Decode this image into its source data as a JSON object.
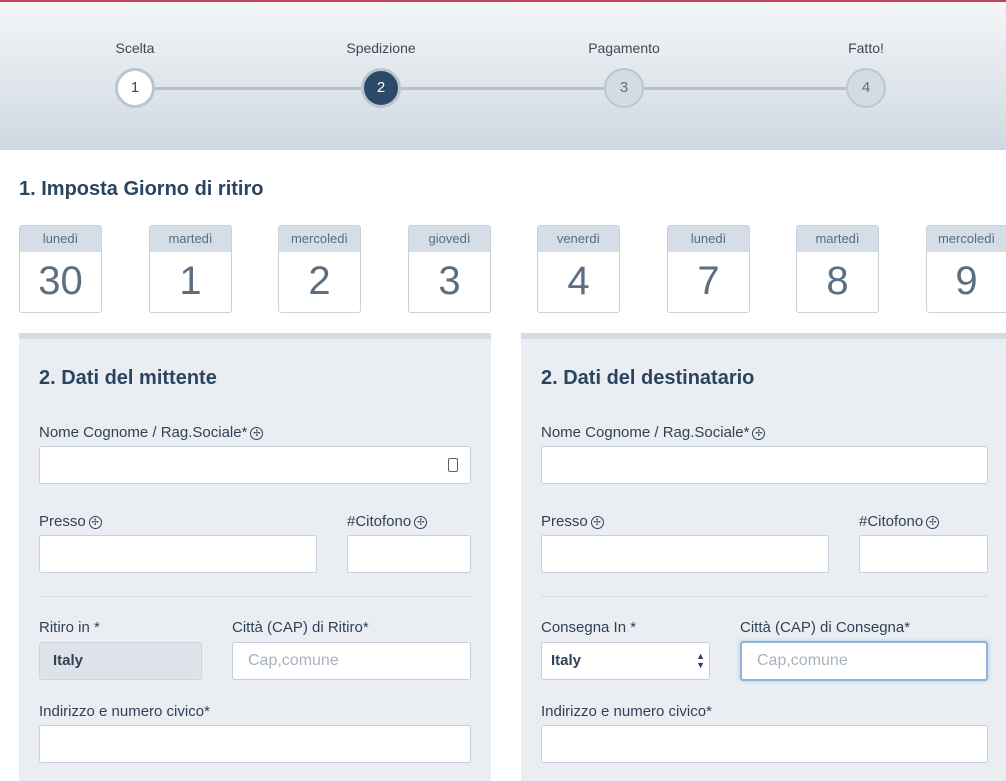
{
  "stepper": {
    "steps": [
      {
        "label": "Scelta",
        "number": "1",
        "state": "done"
      },
      {
        "label": "Spedizione",
        "number": "2",
        "state": "active"
      },
      {
        "label": "Pagamento",
        "number": "3",
        "state": "pending"
      },
      {
        "label": "Fatto!",
        "number": "4",
        "state": "pending"
      }
    ]
  },
  "pickup": {
    "title": "1. Imposta Giorno di ritiro",
    "days": [
      {
        "name": "lunedì",
        "number": "30"
      },
      {
        "name": "martedì",
        "number": "1"
      },
      {
        "name": "mercoledì",
        "number": "2"
      },
      {
        "name": "giovedì",
        "number": "3"
      },
      {
        "name": "venerdì",
        "number": "4"
      },
      {
        "name": "lunedì",
        "number": "7"
      },
      {
        "name": "martedì",
        "number": "8"
      },
      {
        "name": "mercoledì",
        "number": "9"
      }
    ]
  },
  "sender": {
    "title": "2. Dati del mittente",
    "name_label": "Nome Cognome / Rag.Sociale*",
    "name_value": "",
    "presso_label": "Presso",
    "citofono_label": "#Citofono",
    "country_label": "Ritiro in *",
    "country_value": "Italy",
    "city_label": "Città (CAP) di Ritiro*",
    "city_placeholder": "Cap,comune",
    "address_label": "Indirizzo e numero civico*"
  },
  "recipient": {
    "title": "2. Dati del destinatario",
    "name_label": "Nome Cognome / Rag.Sociale*",
    "presso_label": "Presso",
    "citofono_label": "#Citofono",
    "country_label": "Consegna In *",
    "country_value": "Italy",
    "city_label": "Città (CAP) di Consegna*",
    "city_placeholder": "Cap,comune",
    "address_label": "Indirizzo e numero civico*"
  },
  "icons": {
    "help": "help-lifebuoy-icon",
    "contact_card": "contact-card-icon",
    "select_arrows": "select-arrows-icon"
  },
  "colors": {
    "accent_line": "#c0425c",
    "active_step": "#2c4a67",
    "heading": "#2b4560",
    "panel_bg": "#eaeef2"
  }
}
